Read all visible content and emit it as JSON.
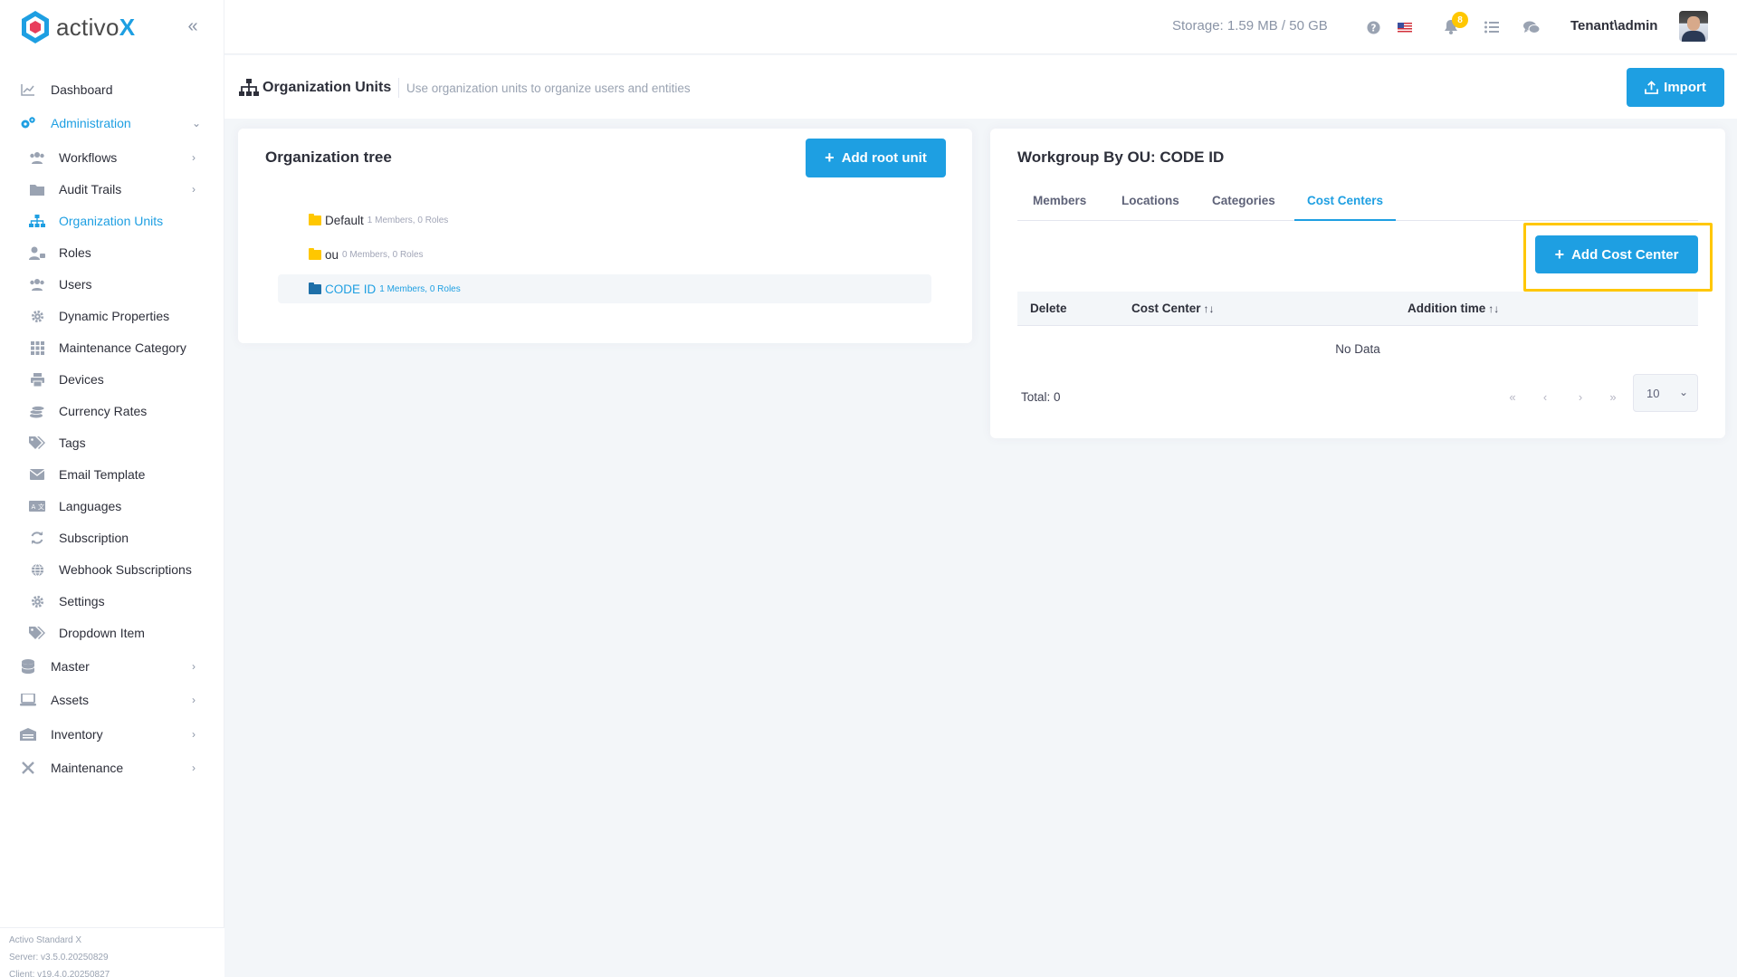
{
  "brand": {
    "name": "activo",
    "name_accent": "X"
  },
  "sidebar": {
    "items": [
      {
        "label": "Dashboard",
        "icon": "chart-line-icon",
        "level": "top"
      },
      {
        "label": "Administration",
        "icon": "cogs-icon",
        "level": "top"
      },
      {
        "label": "Workflows",
        "icon": "users-icon",
        "level": "sub"
      },
      {
        "label": "Audit Trails",
        "icon": "folder-icon",
        "level": "sub"
      },
      {
        "label": "Organization Units",
        "icon": "sitemap-icon",
        "level": "sub"
      },
      {
        "label": "Roles",
        "icon": "user-tag-icon",
        "level": "sub"
      },
      {
        "label": "Users",
        "icon": "users-icon",
        "level": "sub"
      },
      {
        "label": "Dynamic Properties",
        "icon": "gear-icon",
        "level": "sub"
      },
      {
        "label": "Maintenance Category",
        "icon": "grid-icon",
        "level": "sub"
      },
      {
        "label": "Devices",
        "icon": "printer-icon",
        "level": "sub"
      },
      {
        "label": "Currency Rates",
        "icon": "coins-icon",
        "level": "sub"
      },
      {
        "label": "Tags",
        "icon": "tags-icon",
        "level": "sub"
      },
      {
        "label": "Email Template",
        "icon": "envelope-icon",
        "level": "sub"
      },
      {
        "label": "Languages",
        "icon": "language-icon",
        "level": "sub"
      },
      {
        "label": "Subscription",
        "icon": "sync-icon",
        "level": "sub"
      },
      {
        "label": "Webhook Subscriptions",
        "icon": "globe-icon",
        "level": "sub"
      },
      {
        "label": "Settings",
        "icon": "gear-icon",
        "level": "sub"
      },
      {
        "label": "Dropdown Item",
        "icon": "tags-icon",
        "level": "sub"
      },
      {
        "label": "Master",
        "icon": "database-icon",
        "level": "top"
      },
      {
        "label": "Assets",
        "icon": "laptop-icon",
        "level": "top"
      },
      {
        "label": "Inventory",
        "icon": "warehouse-icon",
        "level": "top"
      },
      {
        "label": "Maintenance",
        "icon": "tools-icon",
        "level": "top"
      }
    ],
    "footer": {
      "product": "Activo Standard X",
      "server": "Server: v3.5.0.20250829",
      "client": "Client: v19.4.0.20250827"
    }
  },
  "header": {
    "storage": "Storage: 1.59 MB / 50 GB",
    "notification_count": "8",
    "user": "Tenant\\admin"
  },
  "page": {
    "title": "Organization Units",
    "description": "Use organization units to organize users and entities",
    "import_label": "Import"
  },
  "tree": {
    "title": "Organization tree",
    "add_root_label": "Add root unit",
    "nodes": [
      {
        "name": "Default",
        "meta": "1 Members, 0 Roles"
      },
      {
        "name": "ou",
        "meta": "0 Members, 0 Roles"
      },
      {
        "name": "CODE ID",
        "meta": "1 Members, 0 Roles"
      }
    ]
  },
  "workgroup": {
    "title": "Workgroup By OU: CODE ID",
    "tabs": [
      "Members",
      "Locations",
      "Categories",
      "Cost Centers"
    ],
    "active_tab": "Cost Centers",
    "add_label": "Add Cost Center",
    "columns": [
      "Delete",
      "Cost Center",
      "Addition time"
    ],
    "empty_text": "No Data",
    "total": "Total: 0",
    "page_size": "10"
  },
  "colors": {
    "accent": "#1e9fe2",
    "highlight": "#ffc700",
    "folder": "#ffc700"
  }
}
